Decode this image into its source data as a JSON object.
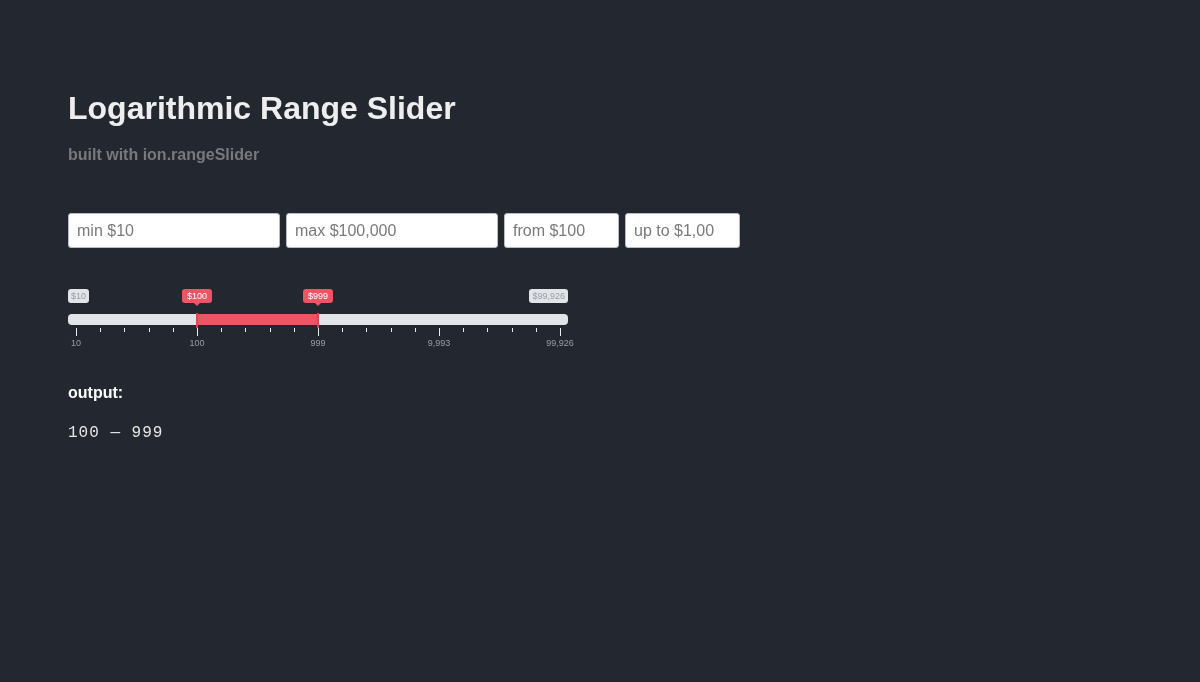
{
  "title": "Logarithmic Range Slider",
  "subtitle": "built with ion.rangeSlider",
  "fields": [
    {
      "placeholder": "min $10"
    },
    {
      "placeholder": "max $100,000"
    },
    {
      "placeholder": "from $100"
    },
    {
      "placeholder": "up to $1,00"
    }
  ],
  "slider": {
    "min_label": "$10",
    "max_label": "$99,926",
    "handles": [
      {
        "label": "$100",
        "level": 0.25
      },
      {
        "label": "$999",
        "level": 0.5
      }
    ],
    "scale": [
      "10",
      "100",
      "999",
      "9,993",
      "99,926"
    ]
  },
  "output": {
    "label": "output:",
    "value": "100 — 999"
  }
}
